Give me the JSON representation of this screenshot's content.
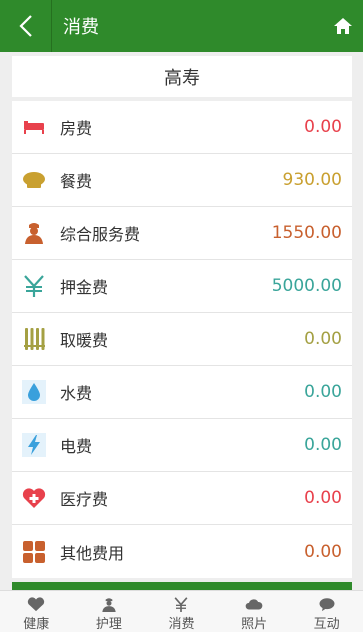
{
  "header": {
    "title": "消费"
  },
  "resident": {
    "name": "高寿"
  },
  "items": [
    {
      "label": "房费",
      "value": "0.00",
      "color": "#e8414c",
      "icon": "bed-icon"
    },
    {
      "label": "餐费",
      "value": "930.00",
      "color": "#c9a030",
      "icon": "chef-hat-icon"
    },
    {
      "label": "综合服务费",
      "value": "1550.00",
      "color": "#c8602e",
      "icon": "caregiver-icon"
    },
    {
      "label": "押金费",
      "value": "5000.00",
      "color": "#3aa59a",
      "icon": "yen-icon"
    },
    {
      "label": "取暖费",
      "value": "0.00",
      "color": "#a4a043",
      "icon": "radiator-icon"
    },
    {
      "label": "水费",
      "value": "0.00",
      "color": "#3aa59a",
      "icon": "water-drop-icon"
    },
    {
      "label": "电费",
      "value": "0.00",
      "color": "#3aa59a",
      "icon": "lightning-icon"
    },
    {
      "label": "医疗费",
      "value": "0.00",
      "color": "#e8414c",
      "icon": "medical-heart-icon"
    },
    {
      "label": "其他费用",
      "value": "0.00",
      "color": "#c8602e",
      "icon": "grid-icon"
    }
  ],
  "tabs": [
    {
      "label": "健康",
      "icon": "heart-icon"
    },
    {
      "label": "护理",
      "icon": "nurse-icon"
    },
    {
      "label": "消费",
      "icon": "yen-icon"
    },
    {
      "label": "照片",
      "icon": "cloud-icon"
    },
    {
      "label": "互动",
      "icon": "chat-bubble-icon"
    }
  ]
}
